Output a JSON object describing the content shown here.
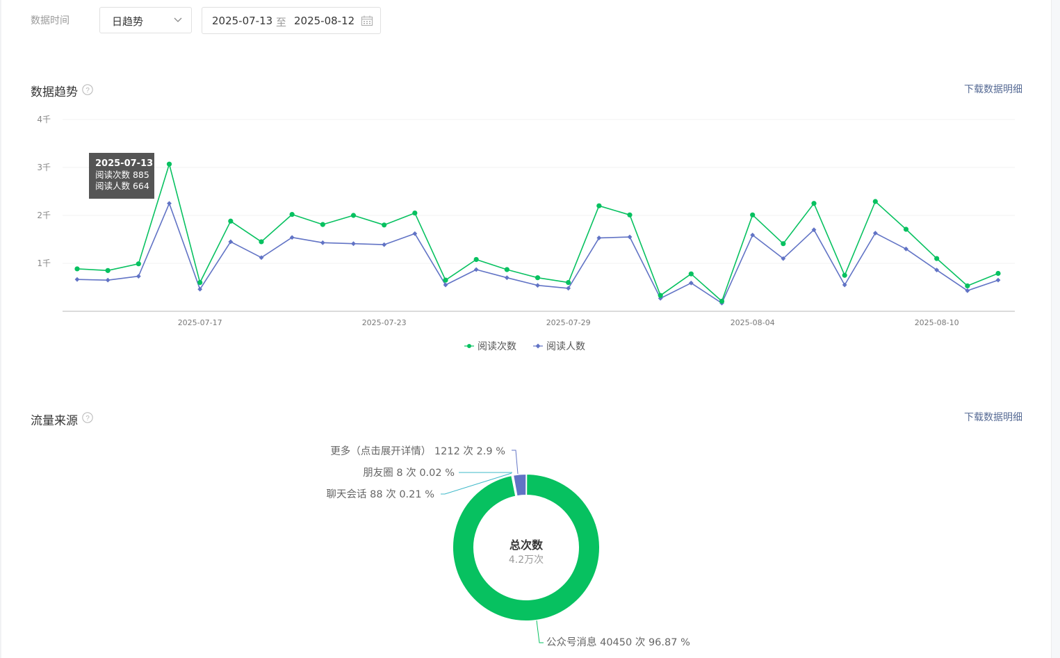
{
  "filters": {
    "label": "数据时间",
    "granularity": "日趋势",
    "start_date": "2025-07-13",
    "range_sep": "至",
    "end_date": "2025-08-12"
  },
  "trend_section": {
    "title": "数据趋势",
    "download": "下载数据明细"
  },
  "tooltip": {
    "date": "2025-07-13",
    "line1": "阅读次数 885",
    "line2": "阅读人数 664"
  },
  "chart_data": {
    "type": "line",
    "x": [
      "2025-07-13",
      "2025-07-14",
      "2025-07-15",
      "2025-07-16",
      "2025-07-17",
      "2025-07-18",
      "2025-07-19",
      "2025-07-20",
      "2025-07-21",
      "2025-07-22",
      "2025-07-23",
      "2025-07-24",
      "2025-07-25",
      "2025-07-26",
      "2025-07-27",
      "2025-07-28",
      "2025-07-29",
      "2025-07-30",
      "2025-07-31",
      "2025-08-01",
      "2025-08-02",
      "2025-08-03",
      "2025-08-04",
      "2025-08-05",
      "2025-08-06",
      "2025-08-07",
      "2025-08-08",
      "2025-08-09",
      "2025-08-10",
      "2025-08-11",
      "2025-08-12"
    ],
    "series": [
      {
        "name": "阅读次数",
        "color": "#07c160",
        "marker": "circle",
        "values": [
          885,
          850,
          990,
          3070,
          600,
          1880,
          1450,
          2020,
          1810,
          2000,
          1800,
          2050,
          650,
          1080,
          870,
          700,
          600,
          2200,
          2010,
          330,
          780,
          210,
          2010,
          1410,
          2250,
          750,
          2290,
          1710,
          1100,
          530,
          790
        ]
      },
      {
        "name": "阅读人数",
        "color": "#6173c5",
        "marker": "diamond",
        "values": [
          664,
          650,
          730,
          2250,
          460,
          1450,
          1120,
          1540,
          1430,
          1410,
          1390,
          1620,
          550,
          870,
          700,
          540,
          480,
          1530,
          1550,
          270,
          590,
          170,
          1590,
          1100,
          1700,
          550,
          1630,
          1300,
          860,
          430,
          650
        ]
      }
    ],
    "ylim": [
      0,
      4000
    ],
    "yticks": [
      "1千",
      "2千",
      "3千",
      "4千"
    ],
    "ytick_values": [
      1000,
      2000,
      3000,
      4000
    ],
    "xticks": [
      "2025-07-17",
      "2025-07-23",
      "2025-07-29",
      "2025-08-04",
      "2025-08-10"
    ],
    "grid": true,
    "legend": "bottom-center"
  },
  "source_section": {
    "title": "流量来源",
    "download": "下载数据明细",
    "center_title": "总次数",
    "center_value": "4.2万次",
    "slices": [
      {
        "name": "公众号消息",
        "label": "公众号消息 40450 次 96.87 %",
        "count": 40450,
        "percent": 96.87,
        "color": "#07c160"
      },
      {
        "name": "聊天会话",
        "label": "聊天会话 88 次 0.21 %",
        "count": 88,
        "percent": 0.21,
        "color": "#3db8c9"
      },
      {
        "name": "朋友圈",
        "label": "朋友圈 8 次 0.02 %",
        "count": 8,
        "percent": 0.02,
        "color": "#3db8c9"
      },
      {
        "name": "更多",
        "label": "更多（点击展开详情） 1212 次 2.9 %",
        "count": 1212,
        "percent": 2.9,
        "color": "#6173c5"
      }
    ]
  }
}
